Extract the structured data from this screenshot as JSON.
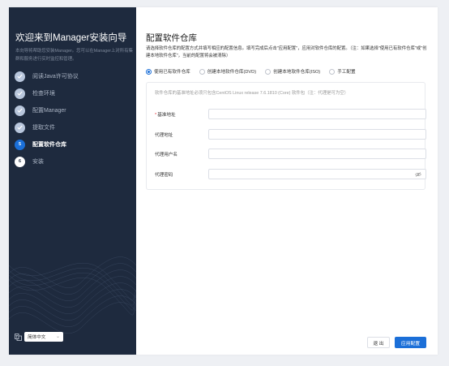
{
  "sidebar": {
    "title": "欢迎来到Manager安装向导",
    "description": "本向导将帮助您安装Manager。您可以在Manager上对所有集群和服务进行实时监控和管理。",
    "steps": [
      {
        "label": "阅读Java许可协议",
        "state": "done"
      },
      {
        "label": "检查环境",
        "state": "done"
      },
      {
        "label": "配置Manager",
        "state": "done"
      },
      {
        "label": "提取文件",
        "state": "done"
      },
      {
        "label": "配置软件仓库",
        "state": "current",
        "number": "5"
      },
      {
        "label": "安装",
        "state": "todo",
        "number": "6"
      }
    ],
    "language": {
      "selected": "简体中文",
      "icon": "language-icon"
    }
  },
  "main": {
    "title": "配置软件仓库",
    "instruction": "请选择软件仓库的配置方式并填写相应的配置信息。填写完成后点击\"应用配置\"，应用对软件仓库的配置。（注：如果选择\"使用已有软件仓库\"或\"创建本地软件仓库\"，当前的配置将会被清除）",
    "repo_options": [
      {
        "label": "使用已有软件仓库",
        "selected": true
      },
      {
        "label": "创建本地软件仓库(DVD)",
        "selected": false
      },
      {
        "label": "创建本地软件仓库(ISO)",
        "selected": false
      },
      {
        "label": "手工配置",
        "selected": false
      }
    ],
    "note": "软件仓库的基准地址必须只包含CentOS Linux release 7.6.1810 (Core) 软件包（注：代理是可为空）",
    "fields": [
      {
        "label": "基准地址",
        "required": true,
        "value": "",
        "placeholder": ""
      },
      {
        "label": "代理地址",
        "required": false,
        "value": "",
        "placeholder": ""
      },
      {
        "label": "代理用户名",
        "required": false,
        "value": "",
        "placeholder": ""
      },
      {
        "label": "代理密码",
        "required": false,
        "value": "",
        "placeholder": ""
      }
    ],
    "password_toggle_icon": "eye-slash-icon"
  },
  "footer": {
    "exit_label": "退 出",
    "apply_label": "应用配置"
  },
  "colors": {
    "sidebar_bg": "#1e2a3e",
    "accent": "#1b6fd8",
    "required": "#e4393c"
  }
}
